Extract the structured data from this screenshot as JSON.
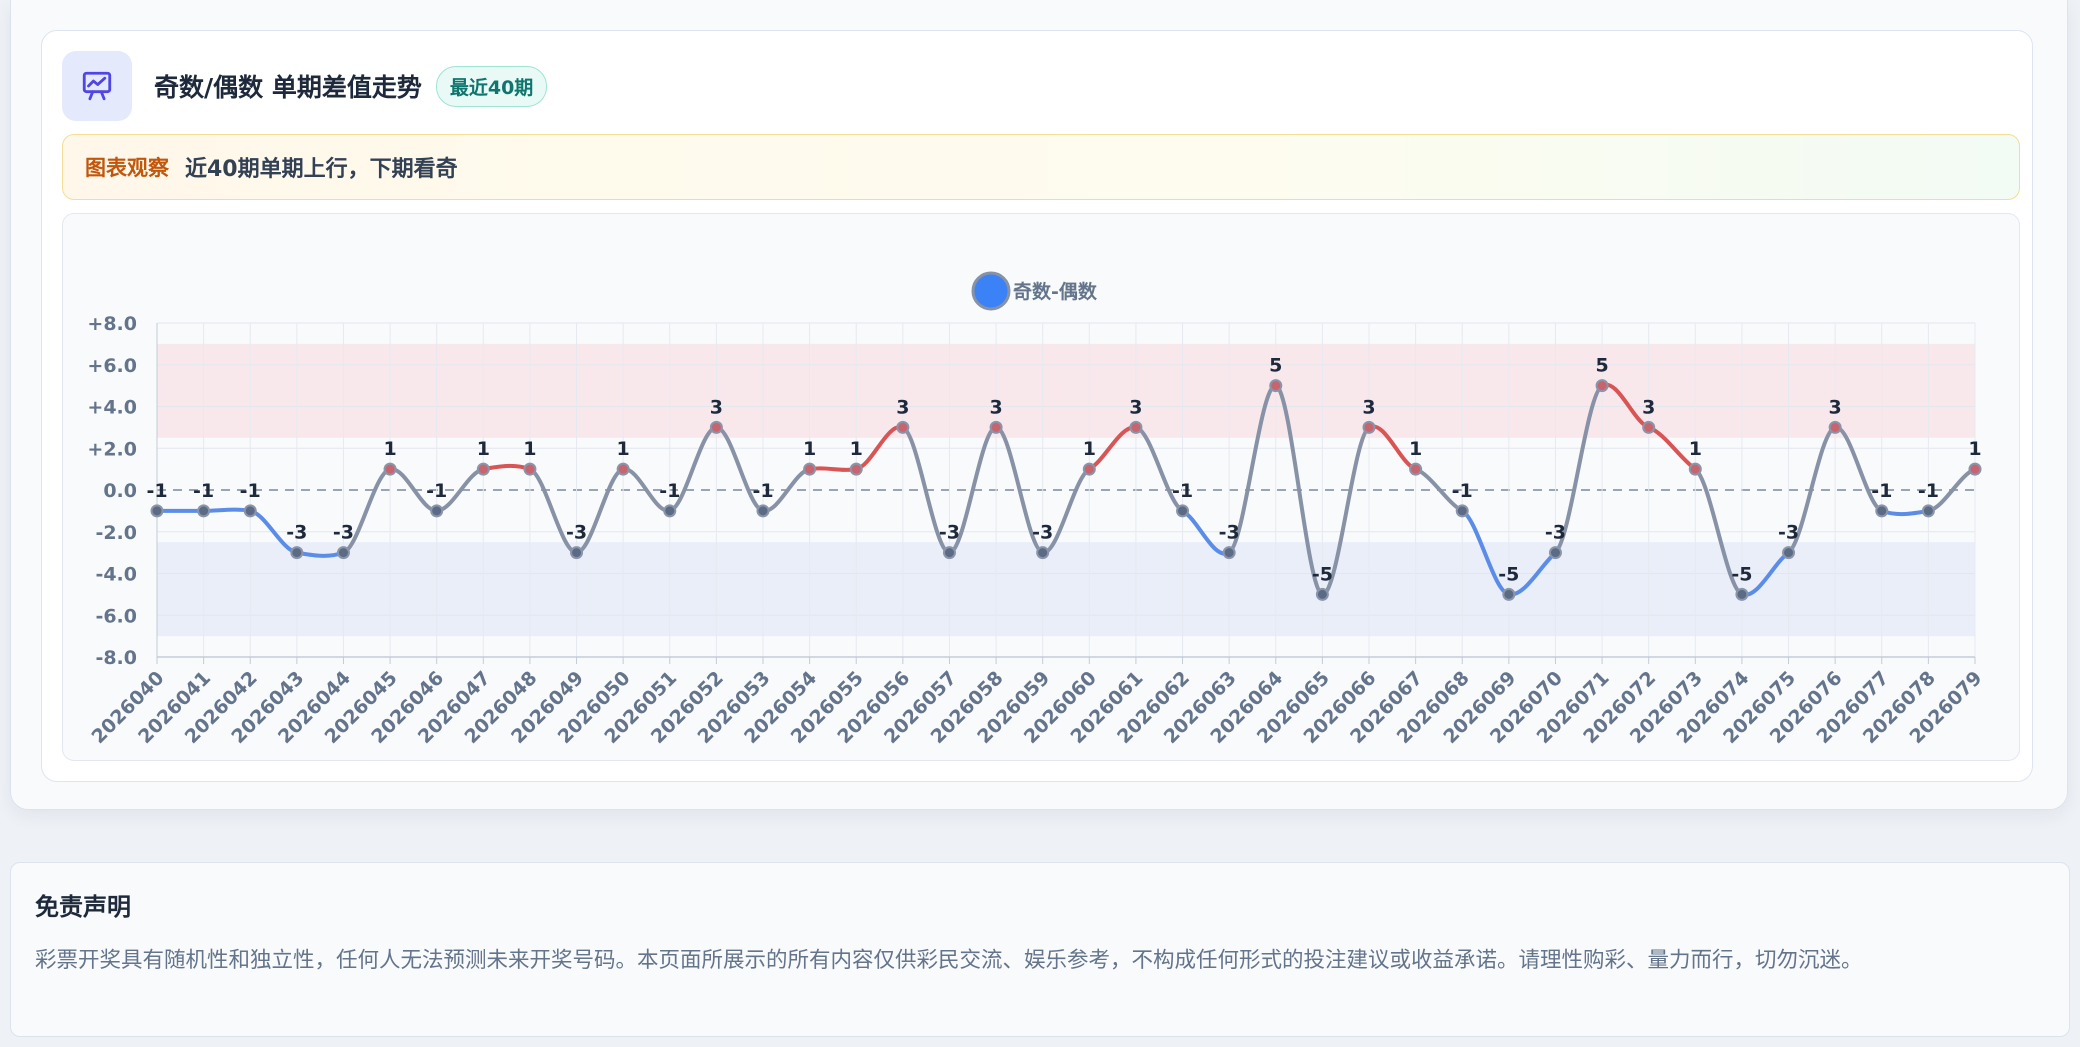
{
  "header": {
    "title": "奇数/偶数 单期差值走势",
    "badge": "最近40期",
    "icon": "presentation-chart-icon"
  },
  "observation": {
    "label": "图表观察",
    "text": "近40期单期上行，下期看奇"
  },
  "disclaimer": {
    "title": "免责声明",
    "text": "彩票开奖具有随机性和独立性，任何人无法预测未来开奖号码。本页面所展示的所有内容仅供彩民交流、娱乐参考，不构成任何形式的投注建议或收益承诺。请理性购彩、量力而行，切勿沉迷。"
  },
  "colors": {
    "accent": "#4f46e5",
    "line_neutral": "#8792a6",
    "line_up": "#d95454",
    "line_down": "#5b8de8",
    "band_high": "#f7e6ea",
    "band_low": "#e7ecf8",
    "legend_dot": "#3b82f6"
  },
  "chart_data": {
    "type": "line",
    "legend": [
      "奇数-偶数"
    ],
    "legend_position": "top-center",
    "ylim": [
      -8,
      8
    ],
    "yticks": [
      "+8.0",
      "+6.0",
      "+4.0",
      "+2.0",
      "0.0",
      "-2.0",
      "-4.0",
      "-6.0",
      "-8.0"
    ],
    "ytick_values": [
      8,
      6,
      4,
      2,
      0,
      -2,
      -4,
      -6,
      -8
    ],
    "grid": true,
    "zero_line": "dashed",
    "bands": [
      {
        "from": 2.5,
        "to": 7,
        "color": "#f7e6ea"
      },
      {
        "from": -7,
        "to": -2.5,
        "color": "#e7ecf8"
      }
    ],
    "categories": [
      "2026040",
      "2026041",
      "2026042",
      "2026043",
      "2026044",
      "2026045",
      "2026046",
      "2026047",
      "2026048",
      "2026049",
      "2026050",
      "2026051",
      "2026052",
      "2026053",
      "2026054",
      "2026055",
      "2026056",
      "2026057",
      "2026058",
      "2026059",
      "2026060",
      "2026061",
      "2026062",
      "2026063",
      "2026064",
      "2026065",
      "2026066",
      "2026067",
      "2026068",
      "2026069",
      "2026070",
      "2026071",
      "2026072",
      "2026073",
      "2026074",
      "2026075",
      "2026076",
      "2026077",
      "2026078",
      "2026079"
    ],
    "series": [
      {
        "name": "奇数-偶数",
        "values": [
          -1,
          -1,
          -1,
          -3,
          -3,
          1,
          -1,
          1,
          1,
          -3,
          1,
          -1,
          3,
          -1,
          1,
          1,
          3,
          -3,
          3,
          -3,
          1,
          3,
          -1,
          -3,
          5,
          -5,
          3,
          1,
          -1,
          -5,
          -3,
          5,
          3,
          1,
          -5,
          -3,
          3,
          -1,
          -1,
          1
        ],
        "data_labels": [
          "-1",
          "-1",
          "-1",
          "-3",
          "-3",
          "1",
          "-1",
          "1",
          "1",
          "-3",
          "1",
          "-1",
          "3",
          "-1",
          "1",
          "1",
          "3",
          "-3",
          "3",
          "-3",
          "1",
          "3",
          "-1",
          "-3",
          "5",
          "-5",
          "3",
          "1",
          "-1",
          "-5",
          "-3",
          "5",
          "3",
          "1",
          "-5",
          "-3",
          "3",
          "-1",
          "-1",
          "1"
        ]
      }
    ]
  }
}
